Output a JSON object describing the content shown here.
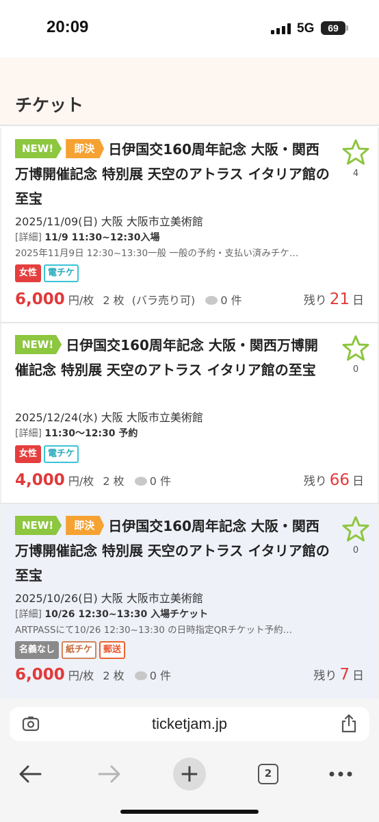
{
  "status": {
    "time": "20:09",
    "network": "5G",
    "battery": "69"
  },
  "page": {
    "title": "チケット"
  },
  "listings": [
    {
      "badges": [
        "NEW!",
        "即決"
      ],
      "title": "日伊国交160周年記念 大阪・関西万博開催記念 特別展 天空のアトラス イタリア館の至宝",
      "fav_count": "4",
      "date_line": "2025/11/09(日) 大阪 大阪市立美術館",
      "detail_bracket": "[詳細]",
      "detail_text": "11/9 11:30~12:30入場",
      "note": "2025年11月9日 12:30~13:30一般 一般の予約・支払い済みチケ…",
      "tags": [
        "女性",
        "電チケ"
      ],
      "price": "6,000",
      "unit_text": "円/枚",
      "quantity": "2 枚",
      "split": "(バラ売り可)",
      "comments": "0 件",
      "remaining_label": "残り",
      "remaining_days": "21",
      "remaining_unit": "日"
    },
    {
      "badges": [
        "NEW!"
      ],
      "title": "日伊国交160周年記念 大阪・関西万博開催記念 特別展 天空のアトラス イタリア館の至宝",
      "fav_count": "0",
      "date_line": "2025/12/24(水) 大阪 大阪市立美術館",
      "detail_bracket": "[詳細]",
      "detail_text": "11:30〜12:30 予約",
      "note": "",
      "tags": [
        "女性",
        "電チケ"
      ],
      "price": "4,000",
      "unit_text": "円/枚",
      "quantity": "2 枚",
      "split": "",
      "comments": "0 件",
      "remaining_label": "残り",
      "remaining_days": "66",
      "remaining_unit": "日"
    },
    {
      "badges": [
        "NEW!",
        "即決"
      ],
      "title": "日伊国交160周年記念 大阪・関西万博開催記念 特別展 天空のアトラス イタリア館の至宝",
      "fav_count": "0",
      "date_line": "2025/10/26(日) 大阪 大阪市立美術館",
      "detail_bracket": "[詳細]",
      "detail_text": "10/26 12:30~13:30 入場チケット",
      "note": "ARTPASSにて10/26 12:30~13:30 の日時指定QRチケット予約…",
      "tags": [
        "名義なし",
        "紙チケ",
        "郵送"
      ],
      "price": "6,000",
      "unit_text": "円/枚",
      "quantity": "2 枚",
      "split": "",
      "comments": "0 件",
      "remaining_label": "残り",
      "remaining_days": "7",
      "remaining_unit": "日"
    }
  ],
  "browser": {
    "url": "ticketjam.jp",
    "tab_count": "2"
  },
  "colors": {
    "accent_red": "#e03a3a",
    "new_badge": "#8dc63f",
    "sokuketsu_badge": "#f5a233",
    "star": "#8dc63f"
  }
}
